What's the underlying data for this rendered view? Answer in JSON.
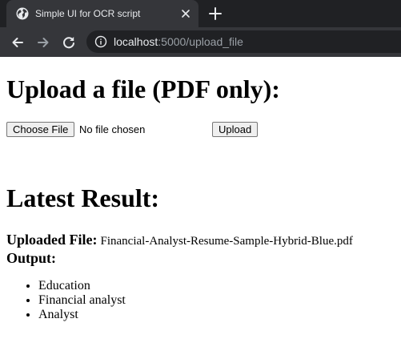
{
  "browser": {
    "tab_title": "Simple UI for OCR script",
    "url_host": "localhost",
    "url_rest": ":5000/upload_file",
    "colors": {
      "tabstrip": "#202124",
      "toolbar": "#35363a",
      "omnibox": "#202124",
      "text": "#e8eaed",
      "muted": "#9aa0a6"
    }
  },
  "page": {
    "upload_heading": "Upload a file (PDF only):",
    "file_button_label": "Choose File",
    "file_status": "No file chosen",
    "upload_button_label": "Upload",
    "result_heading": "Latest Result:",
    "uploaded_file_label": "Uploaded File:",
    "uploaded_file_name": "Financial-Analyst-Resume-Sample-Hybrid-Blue.pdf",
    "output_label": "Output:",
    "output_items": [
      "Education",
      "Financial analyst",
      "Analyst"
    ]
  }
}
